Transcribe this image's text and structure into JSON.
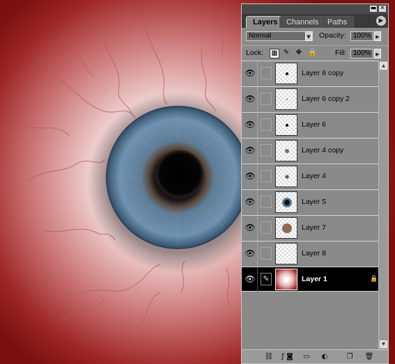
{
  "tabs": [
    {
      "label": "Layers",
      "active": true
    },
    {
      "label": "Channels",
      "active": false
    },
    {
      "label": "Paths",
      "active": false
    }
  ],
  "blend_mode": "Normal",
  "opacity_label": "Opacity:",
  "opacity_value": "100%",
  "lock_label": "Lock:",
  "fill_label": "Fill:",
  "fill_value": "100%",
  "layers": [
    {
      "name": "Layer 6 copy",
      "visible": true,
      "thumb": "small-black-dot",
      "selected": false
    },
    {
      "name": "Layer 6 copy 2",
      "visible": true,
      "thumb": "tiny-brown-dot",
      "selected": false
    },
    {
      "name": "Layer 6",
      "visible": true,
      "thumb": "small-black-dot",
      "selected": false
    },
    {
      "name": "Layer 4 copy",
      "visible": true,
      "thumb": "small-brown-dot",
      "selected": false
    },
    {
      "name": "Layer 4",
      "visible": true,
      "thumb": "small-gray-dot",
      "selected": false
    },
    {
      "name": "Layer 5",
      "visible": true,
      "thumb": "blue-iris-disc",
      "selected": false
    },
    {
      "name": "Layer 7",
      "visible": true,
      "thumb": "brown-disc",
      "selected": false
    },
    {
      "name": "Layer 8",
      "visible": true,
      "thumb": "empty",
      "selected": false
    },
    {
      "name": "Layer 1",
      "visible": true,
      "thumb": "eyeball-gradient",
      "selected": true,
      "locked": true
    }
  ],
  "bottom_icons": [
    "link-layers-icon",
    "layer-style-icon",
    "layer-mask-icon",
    "new-group-icon",
    "adjustment-layer-icon",
    "new-layer-icon",
    "trash-icon"
  ],
  "colors": {
    "canvas_red": "#8b1414",
    "sclera_pink": "#f2d6d6",
    "iris_blue": "#5a7f9e",
    "panel_gray": "#8a8a8a",
    "selected_row": "#000000"
  }
}
